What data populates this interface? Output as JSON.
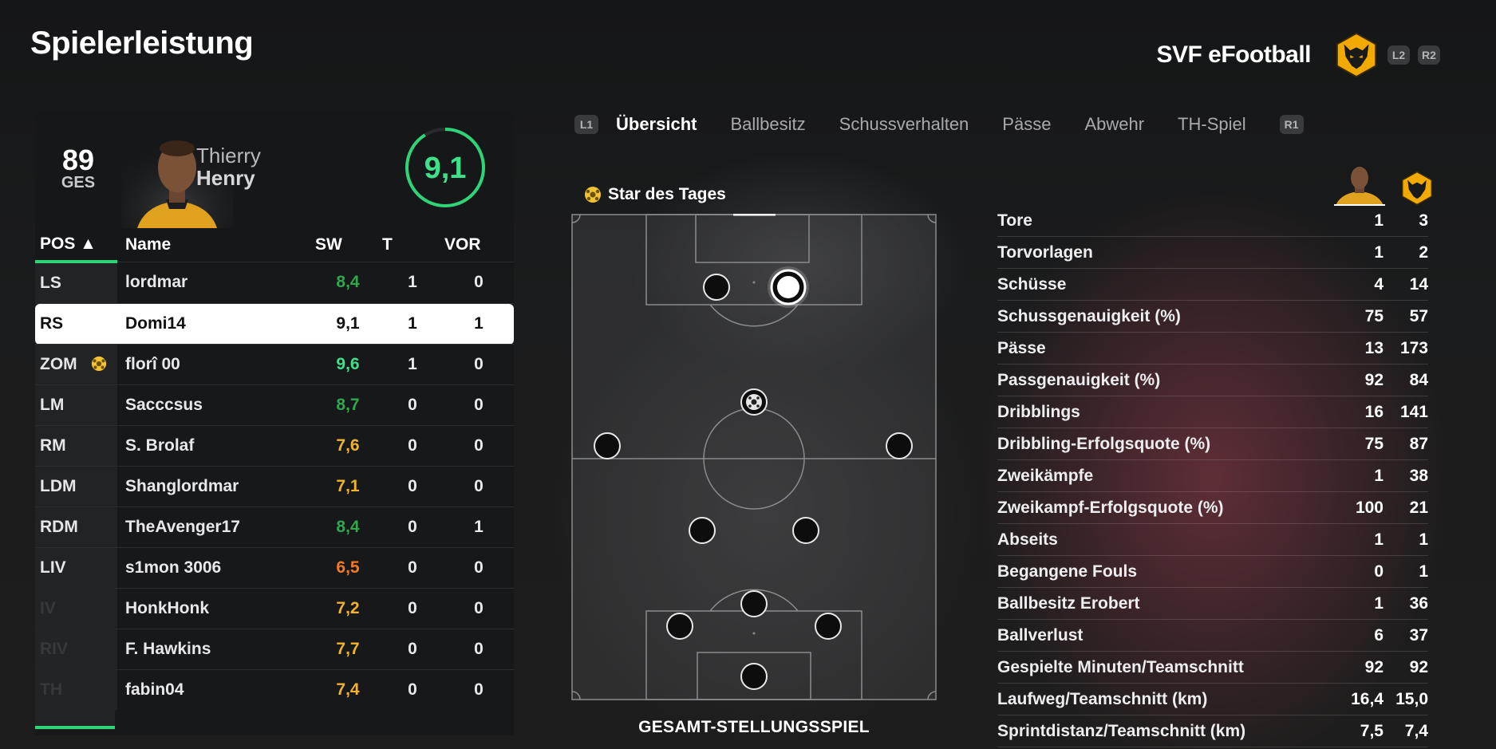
{
  "header": {
    "title": "Spielerleistung",
    "club_name": "SVF eFootball",
    "btn_l2": "L2",
    "btn_r2": "R2"
  },
  "player_card": {
    "rating": "89",
    "rating_label": "GES",
    "first_name": "Thierry",
    "last_name": "Henry",
    "match_score": "9,1",
    "match_score_fraction": 0.91
  },
  "roster": {
    "headers": {
      "pos": "POS ▲",
      "name": "Name",
      "sw": "SW",
      "t": "T",
      "vor": "VOR"
    },
    "rows": [
      {
        "pos": "LS",
        "name": "lordmar",
        "sw": "8,4",
        "t": "1",
        "vor": "0",
        "sw_color": "#2fa84b"
      },
      {
        "pos": "RS",
        "name": "Domi14",
        "sw": "9,1",
        "t": "1",
        "vor": "1",
        "sw_color": "#111111"
      },
      {
        "pos": "ZOM",
        "name": "florî 00",
        "sw": "9,6",
        "t": "1",
        "vor": "0",
        "sw_color": "#3fe08a"
      },
      {
        "pos": "LM",
        "name": "Sacccsus",
        "sw": "8,7",
        "t": "0",
        "vor": "0",
        "sw_color": "#2fa84b"
      },
      {
        "pos": "RM",
        "name": "S. Brolaf",
        "sw": "7,6",
        "t": "0",
        "vor": "0",
        "sw_color": "#f1b32c"
      },
      {
        "pos": "LDM",
        "name": "Shanglordmar",
        "sw": "7,1",
        "t": "0",
        "vor": "0",
        "sw_color": "#f1b32c"
      },
      {
        "pos": "RDM",
        "name": "TheAvenger17",
        "sw": "8,4",
        "t": "0",
        "vor": "1",
        "sw_color": "#2fa84b"
      },
      {
        "pos": "LIV",
        "name": "s1mon 3006",
        "sw": "6,5",
        "t": "0",
        "vor": "0",
        "sw_color": "#f07a26"
      },
      {
        "pos": "IV",
        "name": "HonkHonk",
        "sw": "7,2",
        "t": "0",
        "vor": "0",
        "sw_color": "#f1b32c"
      },
      {
        "pos": "RIV",
        "name": "F. Hawkins",
        "sw": "7,7",
        "t": "0",
        "vor": "0",
        "sw_color": "#f1b32c"
      },
      {
        "pos": "TH",
        "name": "fabin04",
        "sw": "7,4",
        "t": "0",
        "vor": "0",
        "sw_color": "#f1b32c"
      }
    ]
  },
  "tabs": {
    "btn_l1": "L1",
    "btn_r1": "R1",
    "items": [
      "Übersicht",
      "Ballbesitz",
      "Schussverhalten",
      "Pässe",
      "Abwehr",
      "TH-Spiel"
    ],
    "active_index": 0
  },
  "pitch": {
    "star_label": "Star des Tages",
    "caption": "GESAMT-STELLUNGSSPIEL"
  },
  "stats": {
    "rows": [
      {
        "label": "Tore",
        "player": "1",
        "team": "3"
      },
      {
        "label": "Torvorlagen",
        "player": "1",
        "team": "2"
      },
      {
        "label": "Schüsse",
        "player": "4",
        "team": "14"
      },
      {
        "label": "Schussgenauigkeit (%)",
        "player": "75",
        "team": "57"
      },
      {
        "label": "Pässe",
        "player": "13",
        "team": "173"
      },
      {
        "label": "Passgenauigkeit (%)",
        "player": "92",
        "team": "84"
      },
      {
        "label": "Dribblings",
        "player": "16",
        "team": "141"
      },
      {
        "label": "Dribbling-Erfolgsquote (%)",
        "player": "75",
        "team": "87"
      },
      {
        "label": "Zweikämpfe",
        "player": "1",
        "team": "38"
      },
      {
        "label": "Zweikampf-Erfolgsquote (%)",
        "player": "100",
        "team": "21"
      },
      {
        "label": "Abseits",
        "player": "1",
        "team": "1"
      },
      {
        "label": "Begangene Fouls",
        "player": "0",
        "team": "1"
      },
      {
        "label": "Ballbesitz Erobert",
        "player": "1",
        "team": "36"
      },
      {
        "label": "Ballverlust",
        "player": "6",
        "team": "37"
      },
      {
        "label": "Gespielte Minuten/Teamschnitt",
        "player": "92",
        "team": "92"
      },
      {
        "label": "Laufweg/Teamschnitt (km)",
        "player": "16,4",
        "team": "15,0"
      },
      {
        "label": "Sprintdistanz/Teamschnitt (km)",
        "player": "7,5",
        "team": "7,4"
      }
    ]
  },
  "colors": {
    "accent_green": "#2fd477",
    "score_green": "#3fe08a",
    "wolves_gold": "#f2a900"
  }
}
